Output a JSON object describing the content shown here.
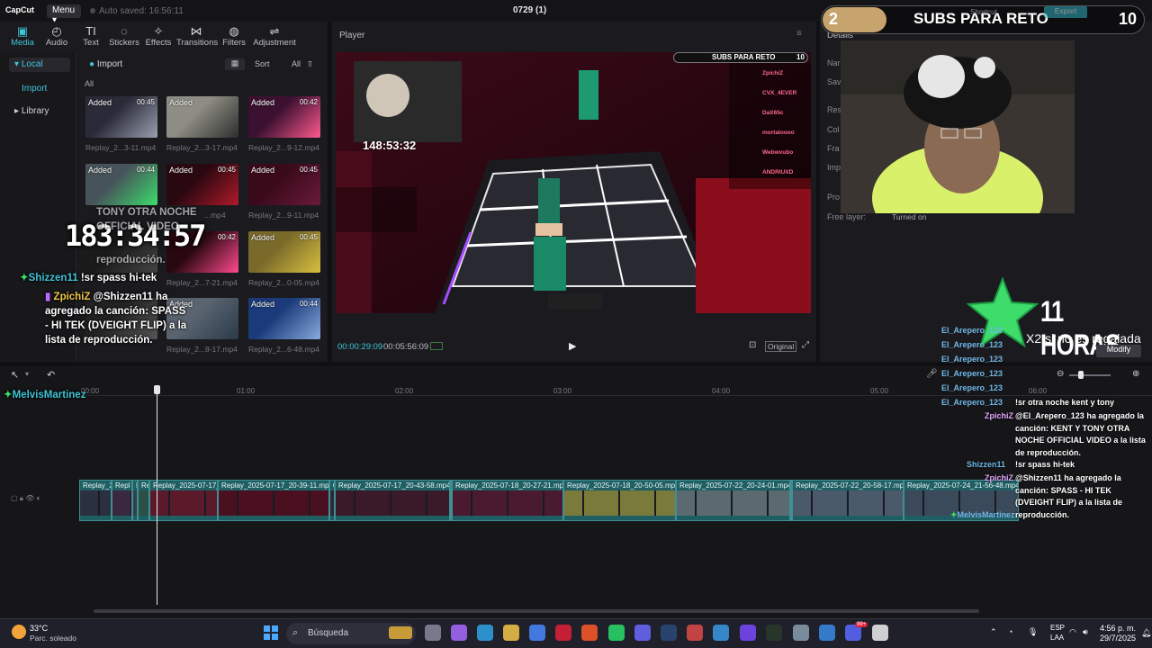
{
  "app": {
    "logo": "CapCut",
    "menu_label": "Menu",
    "autosave": "Auto saved: 16:56:11",
    "project_name": "0729 (1)",
    "shortcut_label": "Shortcut",
    "export_label": "Export"
  },
  "toolbar": {
    "items": [
      {
        "label": "Media",
        "icon": "media-icon"
      },
      {
        "label": "Audio",
        "icon": "audio-icon"
      },
      {
        "label": "Text",
        "icon": "text-icon"
      },
      {
        "label": "Stickers",
        "icon": "stickers-icon"
      },
      {
        "label": "Effects",
        "icon": "effects-icon"
      },
      {
        "label": "Transitions",
        "icon": "transitions-icon"
      },
      {
        "label": "Filters",
        "icon": "filters-icon"
      },
      {
        "label": "Adjustment",
        "icon": "adjustment-icon"
      }
    ]
  },
  "sidenav": {
    "local": "Local",
    "import": "Import",
    "library": "Library"
  },
  "media": {
    "import_label": "Import",
    "sort_label": "Sort",
    "all_label": "All",
    "filter_all": "All",
    "clips": [
      {
        "tag": "Added",
        "duration": "00:45",
        "name": "Replay_2...3-11.mp4"
      },
      {
        "tag": "Added",
        "duration": "",
        "name": "Replay_2...3-17.mp4"
      },
      {
        "tag": "Added",
        "duration": "00:42",
        "name": "Replay_2...9-12.mp4"
      },
      {
        "tag": "Added",
        "duration": "00:44",
        "name": ""
      },
      {
        "tag": "Added",
        "duration": "00:45",
        "name": "...mp4"
      },
      {
        "tag": "Added",
        "duration": "00:45",
        "name": "Replay_2...9-11.mp4"
      },
      {
        "tag": "",
        "duration": "",
        "name": ""
      },
      {
        "tag": "",
        "duration": "00:42",
        "name": "Replay_2...7-21.mp4"
      },
      {
        "tag": "Added",
        "duration": "00:45",
        "name": "Replay_2...0-05.mp4"
      },
      {
        "tag": "",
        "duration": "",
        "name": ""
      },
      {
        "tag": "Added",
        "duration": "",
        "name": "Replay_2...8-17.mp4"
      },
      {
        "tag": "Added",
        "duration": "00:44",
        "name": "Replay_2...6-48.mp4"
      }
    ]
  },
  "player": {
    "title": "Player",
    "current_time": "00:00:29:09",
    "total_time": "00:05:56:09",
    "original_label": "Original",
    "video_overlay": {
      "subs_label": "SUBS PARA RETO",
      "subs_count": "10",
      "timer": "148:53:32",
      "leaderboard": [
        "ZpichiZ",
        "CVX_4EVER",
        "DaX65c",
        "mortaloooo",
        "Webwvubo",
        "ANDRIUXD"
      ]
    }
  },
  "details": {
    "title": "Details",
    "labels": [
      "Nar",
      "Sav",
      "Res",
      "Col",
      "Fra",
      "Imp",
      "Pro",
      "Free layer:"
    ],
    "free_layer_value": "Turned on",
    "modify_label": "Modify"
  },
  "overlay": {
    "subs_left": "2",
    "subs_title": "SUBS PARA RETO",
    "subs_right": "10",
    "subs_progress": 0.2,
    "big_timer": "183:34:57",
    "horas": "11 HORAS",
    "x2": "X2 si no es regalada",
    "left_chat": [
      {
        "user": "",
        "text": "TONY OTRA NOCHE"
      },
      {
        "user": "",
        "text": "OFFICIAL VIDEO"
      },
      {
        "user": "",
        "text": "reproducción."
      },
      {
        "user": "Shizzen11",
        "text": "!sr spass hi-tek"
      },
      {
        "user": "ZpichiZ",
        "text": "@Shizzen11 ha agregado la canción: SPASS - HI TEK (DVEIGHT FLIP) a la lista de reproducción."
      }
    ],
    "timeline_user": "MelvisMartinez",
    "right_names": [
      "El_Arepero_123",
      "El_Arepero_123",
      "El_Arepero_123",
      "El_Arepero_123",
      "El_Arepero_123",
      "El_Arepero_123"
    ],
    "right_chat": [
      {
        "user": "El_Arepero_123",
        "text": "!sr otra noche kent y tony"
      },
      {
        "user": "ZpichiZ",
        "text": "@El_Arepero_123 ha agregado la canción: KENT Y TONY OTRA NOCHE OFFICIAL VIDEO a la lista de reproducción."
      },
      {
        "user": "Shizzen11",
        "text": "!sr spass hi-tek"
      },
      {
        "user": "ZpichiZ",
        "text": "@Shizzen11 ha agregado la canción: SPASS - HI TEK (DVEIGHT FLIP) a la lista de reproducción."
      }
    ],
    "right_bottom_user": "MelvisMartinez"
  },
  "timeline": {
    "ticks": [
      "00:00",
      "01:00",
      "02:00",
      "03:00",
      "04:00",
      "05:00",
      "06:00"
    ],
    "clips": [
      {
        "label": "Replay_2"
      },
      {
        "label": "Repl"
      },
      {
        "label": "R"
      },
      {
        "label": "Re"
      },
      {
        "label": "Replay_2025-07-17_2"
      },
      {
        "label": "Replay_2025-07-17_20-39-11.mp4"
      },
      {
        "label": "0"
      },
      {
        "label": "Replay_2025-07-17_20-43-58.mp4"
      },
      {
        "label": "("
      },
      {
        "label": "Replay_2025-07-18_20-27-21.mp4"
      },
      {
        "label": "Replay_2025-07-18_20-50-05.mp4"
      },
      {
        "label": "Replay_2025-07-22_20-24-01.mp4"
      },
      {
        "label": "("
      },
      {
        "label": "Replay_2025-07-22_20-58-17.mp4"
      },
      {
        "label": "Replay_2025-07-24_21-56-48.mp4"
      }
    ]
  },
  "taskbar": {
    "temperature": "33°C",
    "weather": "Parc. soleado",
    "search_placeholder": "Búsqueda",
    "lang1": "ESP",
    "lang2": "LAA",
    "time": "4:56 p. m.",
    "date": "29/7/2025",
    "badge_count": "99+"
  },
  "colors": {
    "accent": "#3fc4d6",
    "track": "#1f5e63",
    "gold": "#c7a46e",
    "green_star": "#3ddc6b"
  }
}
